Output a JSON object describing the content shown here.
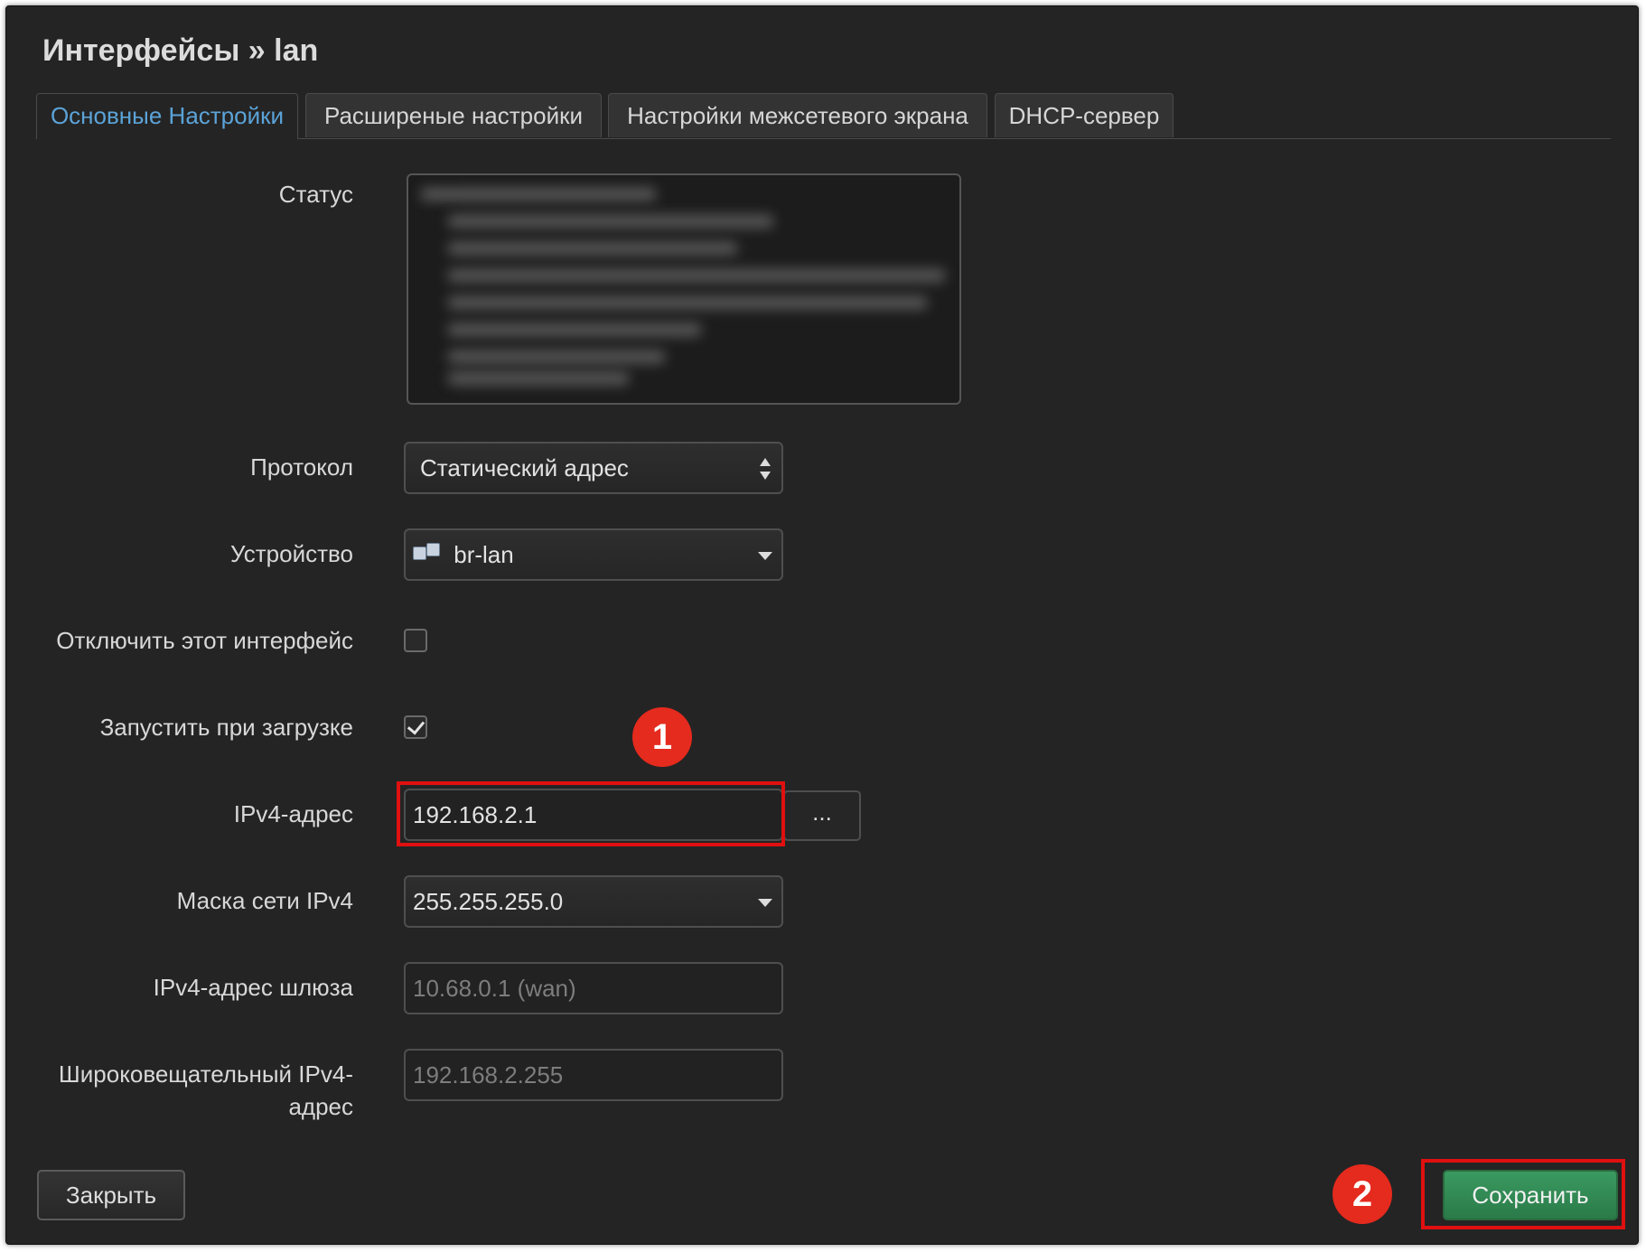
{
  "dialog": {
    "title": "Интерфейсы » lan"
  },
  "tabs": [
    {
      "label": "Основные Настройки",
      "active": true
    },
    {
      "label": "Расширеные настройки",
      "active": false
    },
    {
      "label": "Настройки межсетевого экрана",
      "active": false
    },
    {
      "label": "DHCP-сервер",
      "active": false
    }
  ],
  "form": {
    "status": {
      "label": "Статус"
    },
    "protocol": {
      "label": "Протокол",
      "value": "Статический адрес"
    },
    "device": {
      "label": "Устройство",
      "value": "br-lan",
      "icon": "network-bridge-icon"
    },
    "disable": {
      "label": "Отключить этот интерфейс",
      "checked": false
    },
    "autostart": {
      "label": "Запустить при загрузке",
      "checked": true
    },
    "ipv4_address": {
      "label": "IPv4-адрес",
      "value": "192.168.2.1",
      "more_label": "..."
    },
    "ipv4_netmask": {
      "label": "Маска сети IPv4",
      "value": "255.255.255.0"
    },
    "ipv4_gateway": {
      "label": "IPv4-адрес шлюза",
      "placeholder": "10.68.0.1 (wan)"
    },
    "ipv4_broadcast": {
      "label_line1": "Широковещательный IPv4-",
      "label_line2": "адрес",
      "placeholder": "192.168.2.255"
    }
  },
  "footer": {
    "close_label": "Закрыть",
    "save_label": "Сохранить"
  },
  "annotations": {
    "badge1": "1",
    "badge2": "2",
    "highlight_color": "#e01010",
    "badge_color": "#e52a1e"
  },
  "colors": {
    "background": "#242424",
    "active_tab": "#5ba3d8",
    "save_button": "#2f8a52"
  }
}
